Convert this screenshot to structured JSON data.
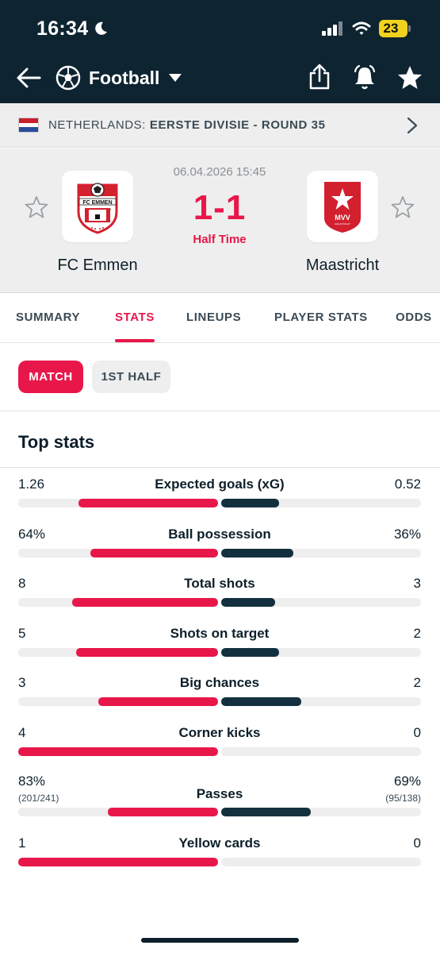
{
  "status_bar": {
    "time": "16:34",
    "battery": "23"
  },
  "app_bar": {
    "sport": "Football"
  },
  "league": {
    "country": "NETHERLANDS:",
    "competition": "EERSTE DIVISIE - ROUND 35"
  },
  "match": {
    "date": "06.04.2026 15:45",
    "score": "1-1",
    "status": "Half Time",
    "home": {
      "name": "FC Emmen",
      "logo_text": "FC EMMEN",
      "logo_year": "1925"
    },
    "away": {
      "name": "Maastricht",
      "logo_text": "MVV",
      "logo_sub": "MAASTRICHT"
    }
  },
  "tabs": [
    {
      "label": "SUMMARY",
      "active": false
    },
    {
      "label": "STATS",
      "active": true
    },
    {
      "label": "LINEUPS",
      "active": false
    },
    {
      "label": "PLAYER STATS",
      "active": false
    },
    {
      "label": "ODDS",
      "active": false
    }
  ],
  "periods": [
    {
      "label": "MATCH",
      "active": true
    },
    {
      "label": "1ST HALF",
      "active": false
    }
  ],
  "top_stats": {
    "title": "Top stats",
    "items": [
      {
        "label": "Expected goals (xG)",
        "home": "1.26",
        "away": "0.52",
        "home_share": 0.7,
        "away_share": 0.29
      },
      {
        "label": "Ball possession",
        "home": "64%",
        "away": "36%",
        "home_share": 0.64,
        "away_share": 0.36
      },
      {
        "label": "Total shots",
        "home": "8",
        "away": "3",
        "home_share": 0.73,
        "away_share": 0.27
      },
      {
        "label": "Shots on target",
        "home": "5",
        "away": "2",
        "home_share": 0.71,
        "away_share": 0.29
      },
      {
        "label": "Big chances",
        "home": "3",
        "away": "2",
        "home_share": 0.6,
        "away_share": 0.4
      },
      {
        "label": "Corner kicks",
        "home": "4",
        "away": "0",
        "home_share": 1.0,
        "away_share": 0.0
      },
      {
        "label": "Passes",
        "home": "83%",
        "away": "69%",
        "home_sub": "(201/241)",
        "away_sub": "(95/138)",
        "home_share": 0.55,
        "away_share": 0.45
      },
      {
        "label": "Yellow cards",
        "home": "1",
        "away": "0",
        "home_share": 1.0,
        "away_share": 0.0
      }
    ]
  },
  "colors": {
    "accent": "#e8174a",
    "dark": "#0e2431",
    "away_bar": "#13303f"
  }
}
